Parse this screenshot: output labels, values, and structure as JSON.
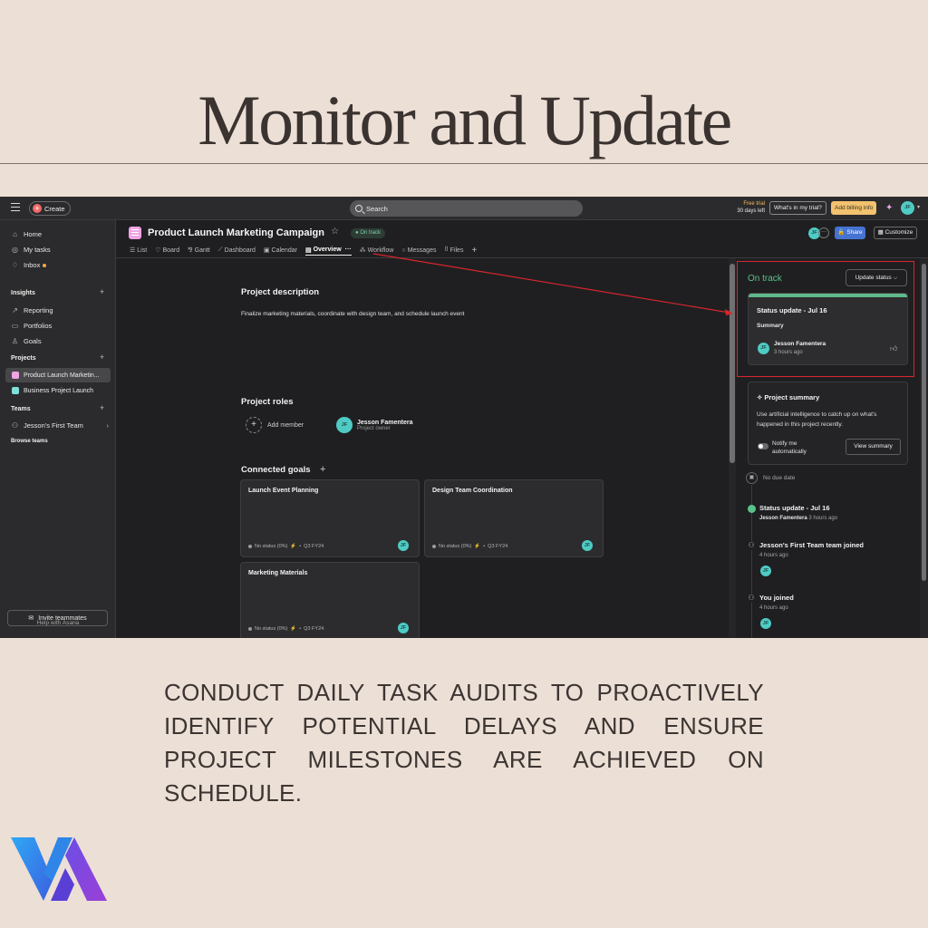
{
  "headline": "Monitor and Update",
  "app": {
    "topbar": {
      "create_label": "Create",
      "search_placeholder": "Search",
      "trial_line1": "Free trial",
      "trial_line2": "30 days left",
      "whats_in_trial": "What's in my trial?",
      "billing_label": "Add billing info",
      "avatar_initials": "JF"
    },
    "sidebar": {
      "main_items": [
        {
          "label": "Home",
          "icon": "home-icon"
        },
        {
          "label": "My tasks",
          "icon": "check-circle-icon"
        },
        {
          "label": "Inbox",
          "icon": "bell-icon"
        }
      ],
      "insights_title": "Insights",
      "insights_items": [
        {
          "label": "Reporting",
          "icon": "chart-icon"
        },
        {
          "label": "Portfolios",
          "icon": "folder-icon"
        },
        {
          "label": "Goals",
          "icon": "person-icon"
        }
      ],
      "projects_title": "Projects",
      "projects": [
        {
          "label": "Product Launch Marketin...",
          "color": "#f1a3e6"
        },
        {
          "label": "Business Project Launch",
          "color": "#7ee0d9"
        }
      ],
      "teams_title": "Teams",
      "team_item": "Jesson's First Team",
      "browse_teams": "Browse teams",
      "invite_label": "Invite teammates",
      "help_label": "Help with Asana"
    },
    "header": {
      "project_title": "Product Launch Marketing Campaign",
      "status_pill": "On track",
      "share_label": "Share",
      "customize_label": "Customize",
      "avatar_initials": "JF"
    },
    "tabs": [
      {
        "label": "List",
        "icon": "list-icon"
      },
      {
        "label": "Board",
        "icon": "board-icon"
      },
      {
        "label": "Gantt",
        "icon": "gantt-icon"
      },
      {
        "label": "Dashboard",
        "icon": "dashboard-icon"
      },
      {
        "label": "Calendar",
        "icon": "calendar-icon"
      },
      {
        "label": "Overview",
        "icon": "overview-icon",
        "active": true
      },
      {
        "label": "Workflow",
        "icon": "workflow-icon"
      },
      {
        "label": "Messages",
        "icon": "message-icon"
      },
      {
        "label": "Files",
        "icon": "file-icon"
      }
    ],
    "overview": {
      "description_title": "Project description",
      "description_text": "Finalize marketing materials, coordinate with design team, and schedule launch event",
      "roles_title": "Project roles",
      "add_member": "Add member",
      "owner_name": "Jesson Famentera",
      "owner_role": "Project owner",
      "owner_initials": "JF",
      "goals_title": "Connected goals",
      "goals": [
        {
          "title": "Launch Event Planning",
          "status": "No status (0%)",
          "period": "Q3 FY24",
          "initials": "JF"
        },
        {
          "title": "Design Team Coordination",
          "status": "No status (0%)",
          "period": "Q3 FY24",
          "initials": "JF"
        },
        {
          "title": "Marketing Materials",
          "status": "No status (0%)",
          "period": "Q3 FY24",
          "initials": "JF"
        }
      ]
    },
    "right_panel": {
      "status": "On track",
      "update_button": "Update status",
      "status_update_title": "Status update - Jul 16",
      "summary_label": "Summary",
      "author": "Jesson Famentera",
      "author_time": "3 hours ago",
      "author_initials": "JF",
      "project_summary_title": "Project summary",
      "project_summary_text": "Use artificial intelligence to catch up on what's happened in this project recently.",
      "notify_label": "Notify me automatically",
      "view_summary": "View summary",
      "no_due_date": "No due date",
      "timeline": [
        {
          "title": "Status update - Jul 16",
          "author": "Jesson Famentera",
          "time": "3 hours ago"
        },
        {
          "title": "Jesson's First Team team joined",
          "time": "4 hours ago",
          "initials": "JF"
        },
        {
          "title": "You joined",
          "time": "4 hours ago",
          "initials": "JF"
        }
      ]
    }
  },
  "body_text": "Conduct daily task audits to proactively identify potential delays and ensure project milestones are achieved on schedule.",
  "colors": {
    "background": "#ecdfd6",
    "app_dark": "#1f1f21",
    "on_track_green": "#58c28a",
    "highlight_red": "#d8262e",
    "logo_blue": "#2f86e8",
    "logo_purple": "#8a3fd6"
  }
}
